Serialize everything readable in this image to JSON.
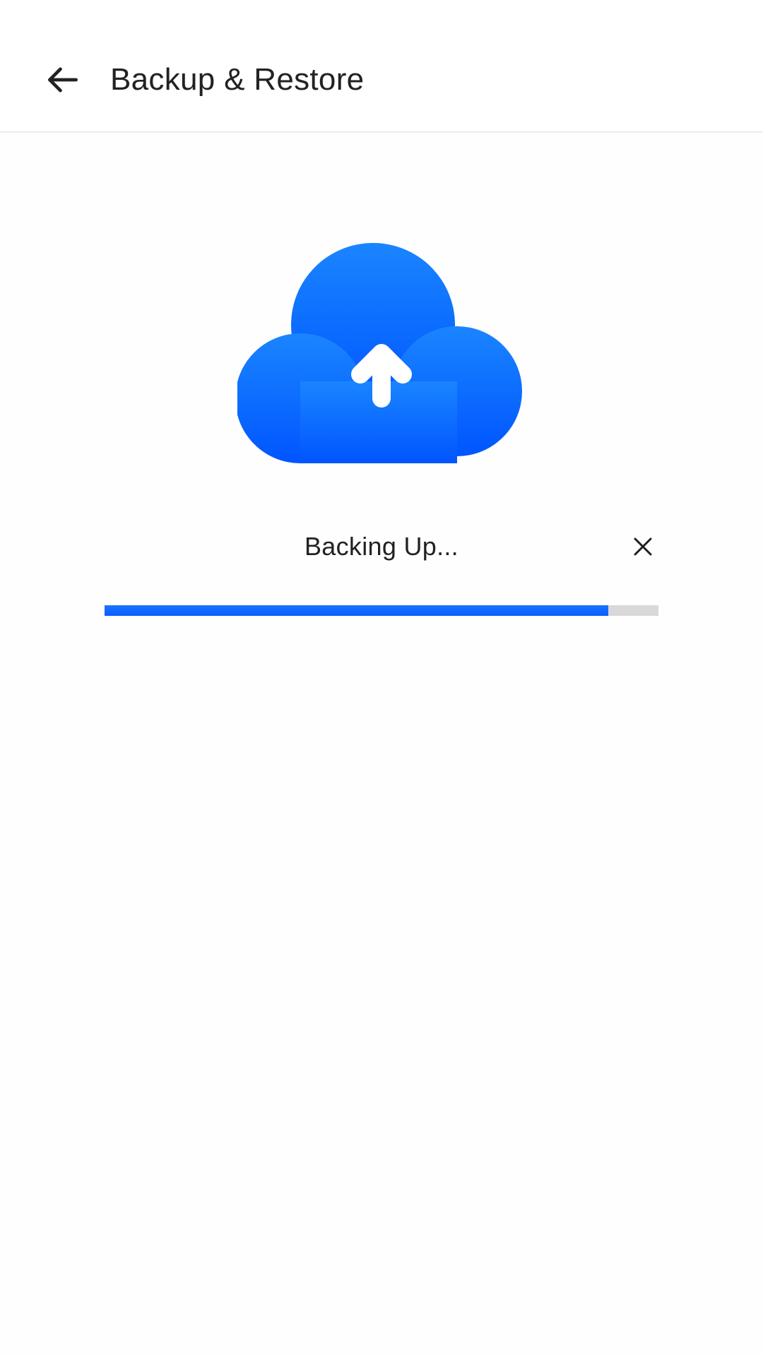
{
  "header": {
    "title": "Backup & Restore",
    "back_icon": "arrow-back-icon"
  },
  "hero": {
    "icon": "cloud-upload-icon",
    "accent_top": "#1A85FF",
    "accent_bottom": "#0055FF"
  },
  "backup": {
    "status": "Backing Up...",
    "cancel_icon": "close-icon",
    "progress_percent": 91,
    "progress_color": "#0B5CFF",
    "track_color": "#D8D8D8"
  }
}
